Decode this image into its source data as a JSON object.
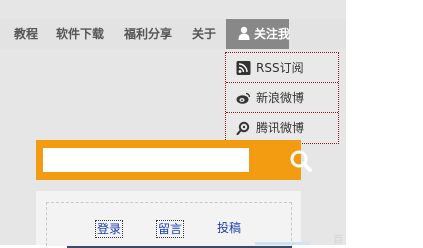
{
  "nav": {
    "items": [
      {
        "label": "教程"
      },
      {
        "label": "软件下载"
      },
      {
        "label": "福利分享"
      },
      {
        "label": "关于"
      }
    ],
    "follow_label": "关注我"
  },
  "dropdown": {
    "items": [
      {
        "label": "RSS订阅",
        "icon": "rss-icon"
      },
      {
        "label": "新浪微博",
        "icon": "weibo-icon"
      },
      {
        "label": "腾讯微博",
        "icon": "tencent-weibo-icon"
      }
    ]
  },
  "search": {
    "placeholder": "",
    "button_icon": "search-icon",
    "accent_color": "#f39c12"
  },
  "card": {
    "links": [
      {
        "label": "登录"
      },
      {
        "label": "留言"
      },
      {
        "label": "投稿"
      }
    ]
  },
  "watermark": "百"
}
